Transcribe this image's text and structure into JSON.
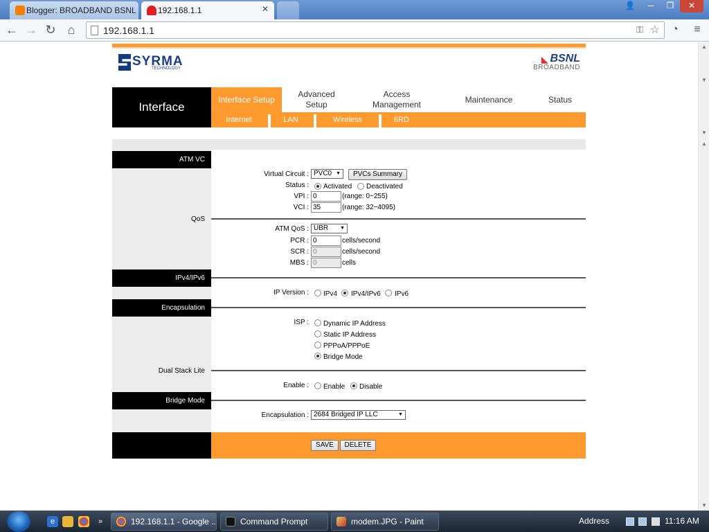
{
  "browser": {
    "tabs": [
      {
        "title": "Blogger: BROADBAND BSNL",
        "active": false
      },
      {
        "title": "192.168.1.1",
        "active": true
      }
    ],
    "url": "192.168.1.1",
    "window_buttons": [
      "user-icon",
      "minimize-icon",
      "restore-icon",
      "close-icon"
    ]
  },
  "header": {
    "left_logo": {
      "text": "SYRMA",
      "sub": "TECHNOLOGY"
    },
    "right_logo": {
      "text": "BSNL",
      "sub": "BROADBAND"
    }
  },
  "nav": {
    "section_title": "Interface",
    "tabs": [
      {
        "label": "Interface Setup",
        "active": true
      },
      {
        "label": "Advanced Setup",
        "active": false
      },
      {
        "label": "Access Management",
        "active": false
      },
      {
        "label": "Maintenance",
        "active": false
      },
      {
        "label": "Status",
        "active": false
      }
    ],
    "subtabs": [
      "Internet",
      "LAN",
      "Wireless",
      "6RD"
    ]
  },
  "sections": {
    "atm_vc": "ATM VC",
    "qos": "QoS",
    "ipv4_ipv6": "IPv4/IPv6",
    "encapsulation": "Encapsulation",
    "dual_stack_lite": "Dual Stack Lite",
    "bridge_mode": "Bridge Mode"
  },
  "form": {
    "virtual_circuit": {
      "label": "Virtual Circuit :",
      "value": "PVC0",
      "summary_button": "PVCs Summary"
    },
    "status": {
      "label": "Status :",
      "options": [
        "Activated",
        "Deactivated"
      ],
      "selected": "Activated"
    },
    "vpi": {
      "label": "VPI :",
      "value": "0",
      "hint": "(range: 0~255)"
    },
    "vci": {
      "label": "VCI :",
      "value": "35",
      "hint": "(range: 32~4095)"
    },
    "atm_qos": {
      "label": "ATM QoS :",
      "value": "UBR"
    },
    "pcr": {
      "label": "PCR :",
      "value": "0",
      "unit": "cells/second"
    },
    "scr": {
      "label": "SCR :",
      "value": "0",
      "unit": "cells/second"
    },
    "mbs": {
      "label": "MBS :",
      "value": "0",
      "unit": "cells"
    },
    "ip_version": {
      "label": "IP Version :",
      "options": [
        "IPv4",
        "IPv4/IPv6",
        "IPv6"
      ],
      "selected": "IPv4/IPv6"
    },
    "isp": {
      "label": "ISP :",
      "options": [
        "Dynamic IP Address",
        "Static IP Address",
        "PPPoA/PPPoE",
        "Bridge Mode"
      ],
      "selected": "Bridge Mode"
    },
    "enable": {
      "label": "Enable :",
      "options": [
        "Enable",
        "Disable"
      ],
      "selected": "Disable"
    },
    "encapsulation": {
      "label": "Encapsulation :",
      "value": "2684 Bridged IP LLC"
    }
  },
  "footer_buttons": {
    "save": "SAVE",
    "delete": "DELETE"
  },
  "taskbar": {
    "tasks": [
      "192.168.1.1 - Google ...",
      "Command Prompt",
      "modem.JPG - Paint"
    ],
    "address_label": "Address",
    "clock": "11:16 AM"
  }
}
